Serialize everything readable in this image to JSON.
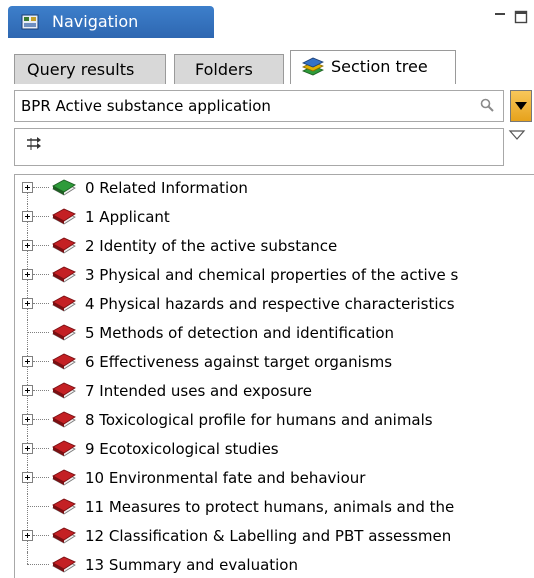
{
  "window": {
    "title": "Navigation"
  },
  "tabs": [
    {
      "label": "Query results",
      "active": false
    },
    {
      "label": "Folders",
      "active": false
    },
    {
      "label": "Section tree",
      "active": true
    }
  ],
  "combo": {
    "value": "BPR Active substance application"
  },
  "colors": {
    "accent": "#2e67b1",
    "book_green": "#2e9b3a",
    "book_red": "#c42024",
    "dropdown": "#e6a21c"
  },
  "tree": {
    "items": [
      {
        "label": "0 Related Information",
        "icon": "green-book-icon",
        "expandable": true
      },
      {
        "label": "1 Applicant",
        "icon": "red-book-icon",
        "expandable": true
      },
      {
        "label": "2 Identity of the active substance",
        "icon": "red-book-icon",
        "expandable": true
      },
      {
        "label": "3 Physical and chemical properties of the active s",
        "icon": "red-book-icon",
        "expandable": true
      },
      {
        "label": "4 Physical hazards and respective characteristics",
        "icon": "red-book-icon",
        "expandable": true
      },
      {
        "label": "5 Methods of detection and identification",
        "icon": "red-book-icon",
        "expandable": false
      },
      {
        "label": "6 Effectiveness against target organisms",
        "icon": "red-book-icon",
        "expandable": true
      },
      {
        "label": "7 Intended uses and exposure",
        "icon": "red-book-icon",
        "expandable": true
      },
      {
        "label": "8 Toxicological profile for humans and animals",
        "icon": "red-book-icon",
        "expandable": true
      },
      {
        "label": "9 Ecotoxicological studies",
        "icon": "red-book-icon",
        "expandable": true
      },
      {
        "label": "10 Environmental fate and behaviour",
        "icon": "red-book-icon",
        "expandable": true
      },
      {
        "label": "11 Measures to protect humans, animals and the",
        "icon": "red-book-icon",
        "expandable": false
      },
      {
        "label": "12 Classification & Labelling and PBT assessmen",
        "icon": "red-book-icon",
        "expandable": true
      },
      {
        "label": "13 Summary and evaluation",
        "icon": "red-book-icon",
        "expandable": false
      }
    ]
  }
}
